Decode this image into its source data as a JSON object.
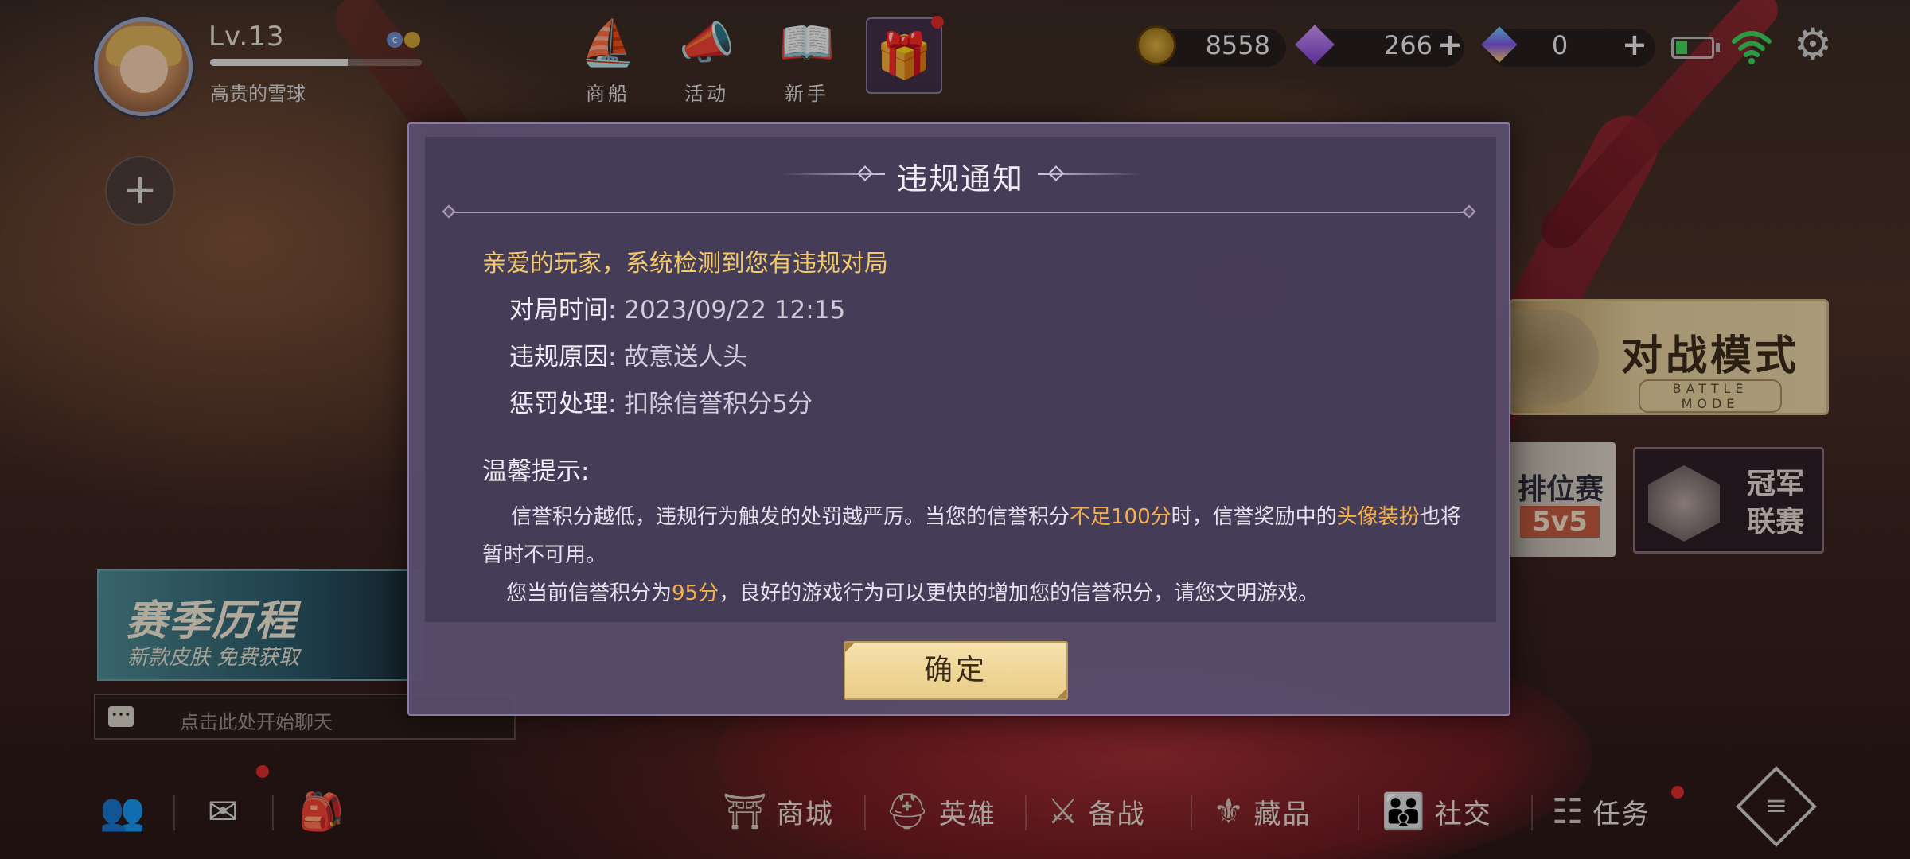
{
  "profile": {
    "level": "Lv.13",
    "level_progress": 0.65,
    "nickname": "高贵的雪球"
  },
  "top_nav": [
    {
      "label": "商船",
      "icon": "ship-icon"
    },
    {
      "label": "活动",
      "icon": "megaphone-icon"
    },
    {
      "label": "新手",
      "icon": "book-icon"
    }
  ],
  "currencies": {
    "coins": "8558",
    "diamonds": "266",
    "crystals": "0"
  },
  "modes": {
    "battle_title": "对战模式",
    "battle_sub": "BATTLE MODE",
    "ranked_title": "排位赛",
    "ranked_sub": "5v5",
    "champion_title": "冠军联赛"
  },
  "season": {
    "title": "赛季历程",
    "subtitle": "新款皮肤 免费获取"
  },
  "chat": {
    "placeholder": "点击此处开始聊天"
  },
  "bottom_nav": [
    {
      "label": "商城"
    },
    {
      "label": "英雄"
    },
    {
      "label": "备战"
    },
    {
      "label": "藏品"
    },
    {
      "label": "社交"
    },
    {
      "label": "任务"
    }
  ],
  "dialog": {
    "title": "违规通知",
    "greeting": "亲爱的玩家，系统检测到您有违规对局",
    "rows": [
      {
        "label": "对局时间",
        "value": ": 2023/09/22 12:15"
      },
      {
        "label": "违规原因",
        "value": ": 故意送人头"
      },
      {
        "label": "惩罚处理",
        "value": ": 扣除信誉积分5分"
      }
    ],
    "tips_title": "温馨提示:",
    "para1_a": "信誉积分越低，违规行为触发的处罚越严厉。当您的信誉积分",
    "para1_hl1": "不足100分",
    "para1_b": "时，信誉奖励中的",
    "para1_hl2": "头像装扮",
    "para1_c": "也将暂时不可用。",
    "para2_a": "您当前信誉积分为",
    "para2_hl": "95分",
    "para2_b": "，良好的游戏行为可以更快的增加您的信誉积分，请您文明游戏。",
    "ok_label": "确定"
  }
}
